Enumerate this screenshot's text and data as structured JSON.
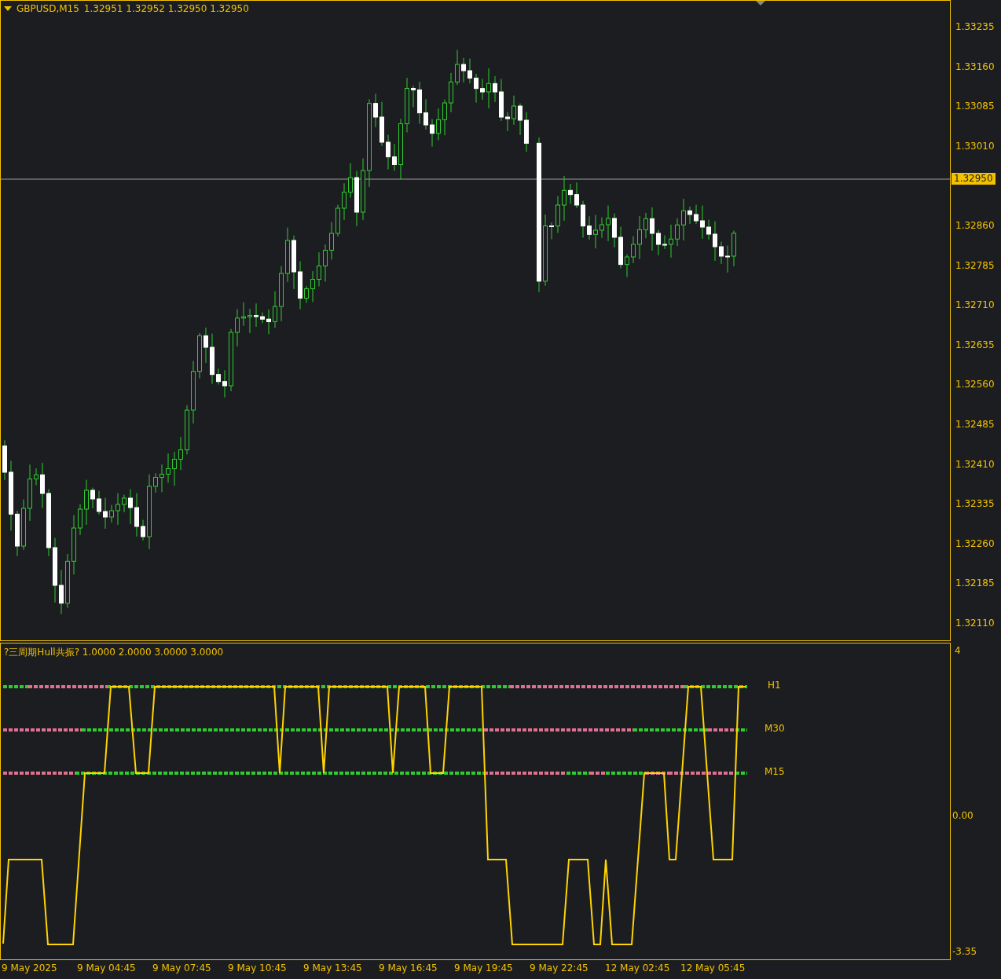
{
  "chart": {
    "symbol": "GBPUSD,M15",
    "quotes": "1.32951 1.32952 1.32950 1.32950",
    "current_price": "1.32950",
    "price_axis": [
      "1.33235",
      "1.33160",
      "1.33085",
      "1.33010",
      "1.32860",
      "1.32785",
      "1.32710",
      "1.32635",
      "1.32560",
      "1.32485",
      "1.32410",
      "1.32335",
      "1.32260",
      "1.32185",
      "1.32110"
    ]
  },
  "indicator": {
    "title": "?三周期Hull共振? 1.0000 2.0000 3.0000 3.0000",
    "levels": [
      "H1",
      "M30",
      "M15"
    ],
    "axis": [
      "4",
      "0.00",
      "-3.35"
    ]
  },
  "time_axis": [
    "9 May 2025",
    "9 May 04:45",
    "9 May 07:45",
    "9 May 10:45",
    "9 May 13:45",
    "9 May 16:45",
    "9 May 19:45",
    "9 May 22:45",
    "12 May 02:45",
    "12 May 05:45"
  ]
}
